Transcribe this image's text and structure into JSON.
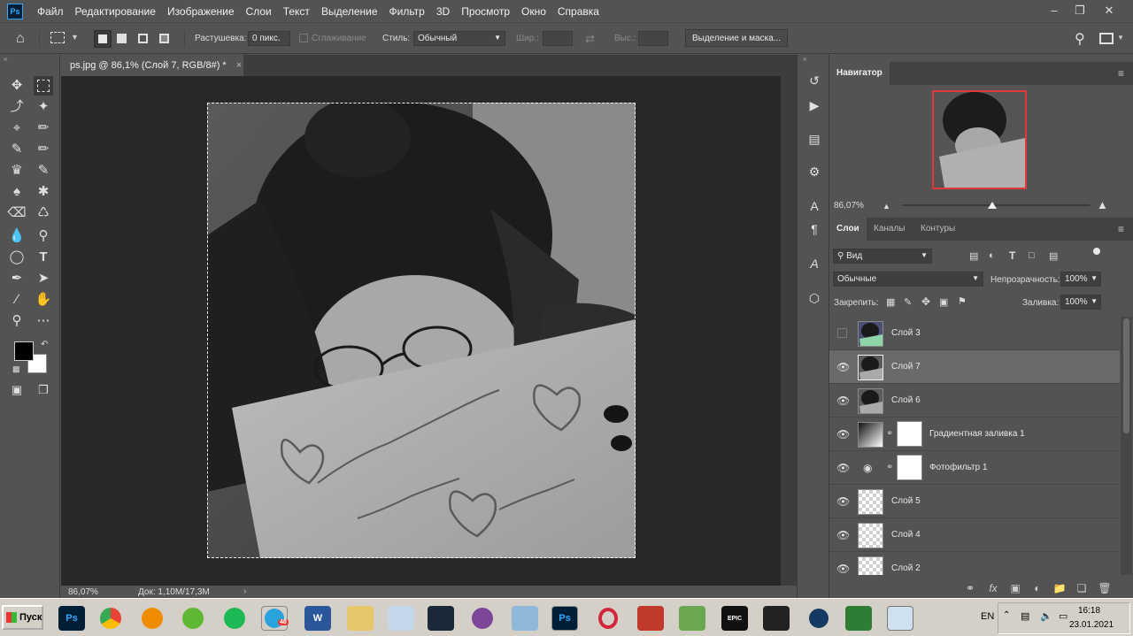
{
  "app": {
    "logo_text": "Ps"
  },
  "menu": [
    "Файл",
    "Редактирование",
    "Изображение",
    "Слои",
    "Текст",
    "Выделение",
    "Фильтр",
    "3D",
    "Просмотр",
    "Окно",
    "Справка"
  ],
  "options_bar": {
    "feather_label": "Растушевка:",
    "feather_value": "0 пикс.",
    "antialias_label": "Сглаживание",
    "style_label": "Стиль:",
    "style_value": "Обычный",
    "width_label": "Шир.:",
    "height_label": "Выс.:",
    "select_mask_button": "Выделение и маска..."
  },
  "document": {
    "tab_title": "ps.jpg @ 86,1% (Слой 7, RGB/8#) *",
    "zoom": "86,07%",
    "doc_info": "Док: 1,10М/17,3М"
  },
  "navigator": {
    "title": "Навигатор",
    "zoom": "86,07%"
  },
  "layers_panel": {
    "tabs": [
      "Слои",
      "Каналы",
      "Контуры"
    ],
    "filter_kind": "Вид",
    "blend_mode": "Обычные",
    "opacity_label": "Непрозрачность:",
    "opacity_value": "100%",
    "lock_label": "Закрепить:",
    "fill_label": "Заливка:",
    "fill_value": "100%",
    "layers": [
      {
        "name": "Слой 3",
        "visible": false,
        "selected": false
      },
      {
        "name": "Слой 7",
        "visible": true,
        "selected": true
      },
      {
        "name": "Слой 6",
        "visible": true,
        "selected": false
      },
      {
        "name": "Градиентная заливка 1",
        "visible": true,
        "selected": false
      },
      {
        "name": "Фотофильтр 1",
        "visible": true,
        "selected": false
      },
      {
        "name": "Слой 5",
        "visible": true,
        "selected": false
      },
      {
        "name": "Слой 4",
        "visible": true,
        "selected": false
      },
      {
        "name": "Слой 2",
        "visible": true,
        "selected": false
      }
    ]
  },
  "taskbar": {
    "start_label": "Пуск",
    "language": "EN",
    "time": "16:18",
    "date": "23.01.2021",
    "telegram_badge": "48"
  }
}
